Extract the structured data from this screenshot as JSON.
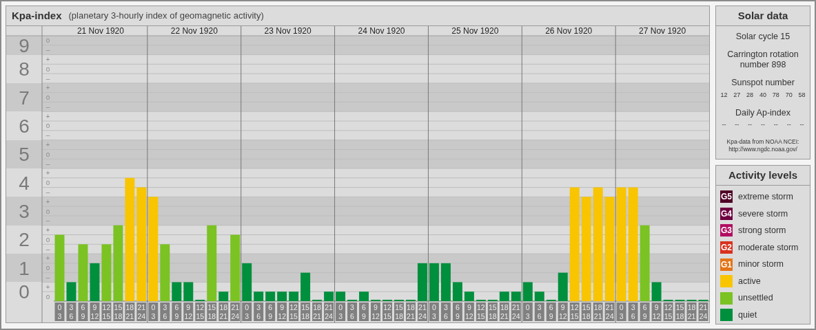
{
  "panel": {
    "title": "Kpa-index",
    "subtitle": "(planetary 3-hourly index of geomagnetic activity)",
    "date_labels": [
      "21 Nov 1920",
      "22 Nov 1920",
      "23 Nov 1920",
      "24 Nov 1920",
      "25 Nov 1920",
      "26 Nov 1920",
      "27 Nov 1920"
    ],
    "minor_tick_labels": [
      "o",
      "–",
      "+",
      "o",
      "–",
      "+",
      "o",
      "–",
      "+",
      "o",
      "–",
      "+",
      "o",
      "–",
      "+",
      "o",
      "–",
      "+",
      "o",
      "–",
      "+",
      "o",
      "–",
      "+",
      "o",
      "–",
      "+",
      "o"
    ],
    "chart_data": {
      "type": "bar",
      "grid": true,
      "categories": [
        "0 3",
        "3 6",
        "6 9",
        "9 12",
        "12 15",
        "15 18",
        "18 21",
        "21 24",
        "0 3",
        "3 6",
        "6 9",
        "9 12",
        "12 15",
        "15 18",
        "18 21",
        "21 24",
        "0 3",
        "3 6",
        "6 9",
        "9 12",
        "12 15",
        "15 18",
        "18 21",
        "21 24",
        "0 3",
        "3 6",
        "6 9",
        "9 12",
        "12 15",
        "15 18",
        "18 21",
        "21 24",
        "0 3",
        "3 6",
        "6 9",
        "9 12",
        "12 15",
        "15 18",
        "18 21",
        "21 24",
        "0 3",
        "3 6",
        "6 9",
        "9 12",
        "12 15",
        "15 18",
        "18 21",
        "21 24",
        "0 3",
        "3 6",
        "6 9",
        "9 12",
        "12 15",
        "15 18",
        "18 21",
        "21 24"
      ],
      "values": [
        2.33,
        0.67,
        2,
        1.33,
        2,
        2.67,
        4.33,
        4,
        3.67,
        2,
        0.67,
        0.67,
        0,
        2.67,
        0.33,
        2.33,
        1.33,
        0.33,
        0.33,
        0.33,
        0.33,
        1,
        0,
        0.33,
        0.33,
        0,
        0.33,
        0,
        0,
        0,
        0,
        1.33,
        1.33,
        1.33,
        0.67,
        0.33,
        0,
        0,
        0.33,
        0.33,
        0.67,
        0.33,
        0,
        1,
        4,
        3.67,
        4,
        3.67,
        4,
        4,
        2.67,
        0.67,
        0,
        0,
        0,
        0
      ],
      "ylim": [
        0,
        9.33
      ],
      "yticks": [
        0,
        1,
        2,
        3,
        4,
        5,
        6,
        7,
        8,
        9
      ]
    }
  },
  "solar_data": {
    "title": "Solar data",
    "solar_cycle": "Solar cycle 15",
    "carrington_rotation": "Carrington rotation number 898",
    "sunspot_label": "Sunspot number",
    "sunspot_numbers": [
      "12",
      "27",
      "28",
      "40",
      "78",
      "70",
      "58"
    ],
    "ap_label": "Daily Ap-index",
    "ap_values": [
      "--",
      "--",
      "--",
      "--",
      "--",
      "--",
      "--"
    ],
    "source_text": "Kpa-data from NOAA NCEI:",
    "source_link": "http://www.ngdc.noaa.gov/"
  },
  "activity_levels": {
    "title": "Activity levels",
    "items": [
      {
        "badge": "G5",
        "label": "extreme storm",
        "color": "#4f0026"
      },
      {
        "badge": "G4",
        "label": "severe storm",
        "color": "#6e0040"
      },
      {
        "badge": "G3",
        "label": "strong storm",
        "color": "#b10e62"
      },
      {
        "badge": "G2",
        "label": "moderate storm",
        "color": "#d9311e"
      },
      {
        "badge": "G1",
        "label": "minor storm",
        "color": "#e47518"
      },
      {
        "label": "active",
        "color": "#f8c500"
      },
      {
        "label": "unsettled",
        "color": "#7bc223"
      },
      {
        "label": "quiet",
        "color": "#008f3d"
      }
    ]
  }
}
